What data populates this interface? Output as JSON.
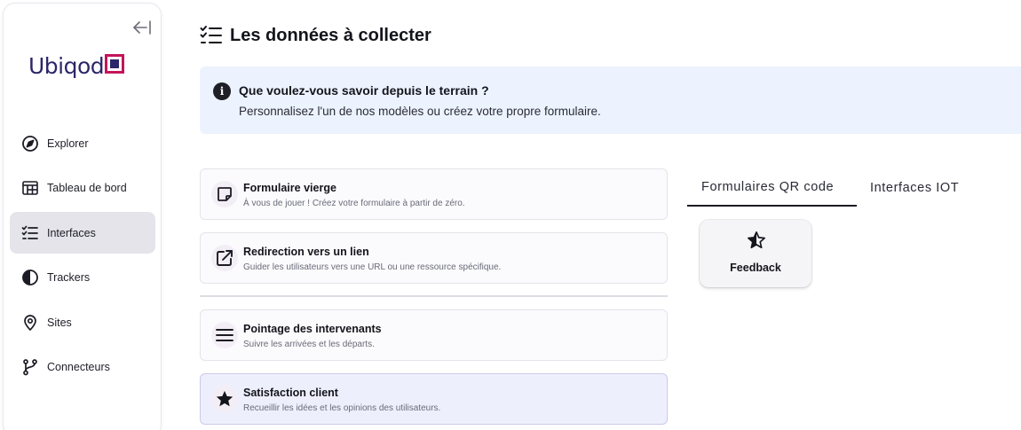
{
  "sidebar": {
    "logo_text": "Ubiqod",
    "items": [
      {
        "label": "Explorer",
        "icon": "compass-icon"
      },
      {
        "label": "Tableau de bord",
        "icon": "dashboard-icon"
      },
      {
        "label": "Interfaces",
        "icon": "checklist-icon",
        "active": true
      },
      {
        "label": "Trackers",
        "icon": "half-circle-icon"
      },
      {
        "label": "Sites",
        "icon": "location-pin-icon"
      },
      {
        "label": "Connecteurs",
        "icon": "branch-icon"
      }
    ]
  },
  "main": {
    "title": "Les données à collecter",
    "info": {
      "title": "Que voulez-vous savoir depuis le terrain ?",
      "text": "Personnalisez l'un de nos modèles ou créez votre propre formulaire."
    },
    "cards": [
      {
        "title": "Formulaire vierge",
        "desc": "À vous de jouer ! Créez votre formulaire à partir de zéro.",
        "icon": "sticky-note-icon"
      },
      {
        "title": "Redirection vers un lien",
        "desc": "Guider les utilisateurs vers une URL ou une ressource spécifique.",
        "icon": "external-link-icon"
      },
      {
        "title": "Pointage des intervenants",
        "desc": "Suivre les arrivées et les départs.",
        "icon": "menu-lines-icon"
      },
      {
        "title": "Satisfaction client",
        "desc": "Recueillir les idées et les opinions des utilisateurs.",
        "icon": "star-icon",
        "selected": true
      }
    ],
    "tabs": [
      {
        "label": "Formulaires QR code",
        "active": true
      },
      {
        "label": "Interfaces IOT",
        "active": false
      }
    ],
    "tile": {
      "label": "Feedback",
      "icon": "half-star-icon"
    }
  },
  "colors": {
    "brand_navy": "#2b2769",
    "brand_magenta": "#c4145a",
    "info_bg": "#ecf3fe",
    "active_nav_bg": "#e4e4ea",
    "selected_card_bg": "#eeeffc"
  }
}
